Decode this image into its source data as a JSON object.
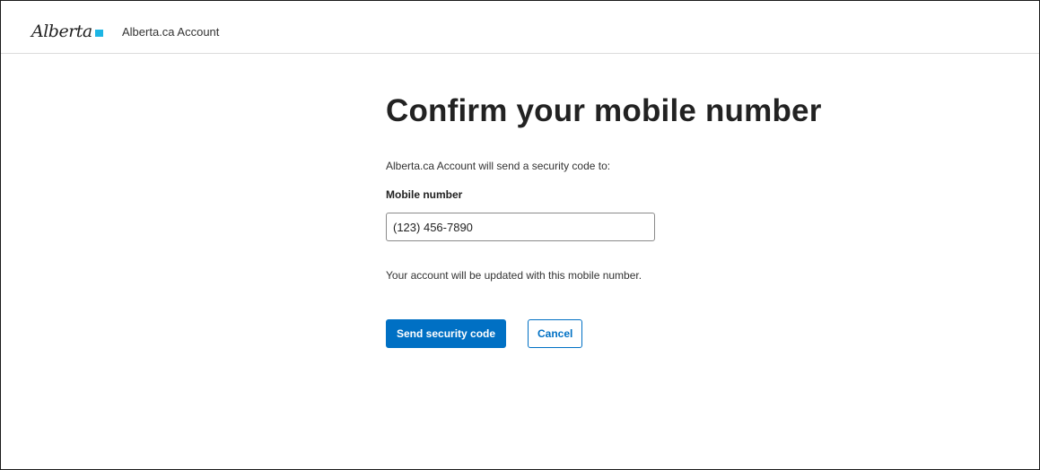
{
  "header": {
    "logo_text": "Alberta",
    "app_name": "Alberta.ca Account"
  },
  "main": {
    "title": "Confirm your mobile number",
    "lead": "Alberta.ca Account will send a security code to:",
    "field_label": "Mobile number",
    "phone_value": "(123) 456-7890",
    "note": "Your account will be updated with this mobile number.",
    "send_button_label": "Send security code",
    "cancel_button_label": "Cancel"
  },
  "colors": {
    "accent": "#0070c4",
    "logo_mark": "#1db5e4"
  }
}
